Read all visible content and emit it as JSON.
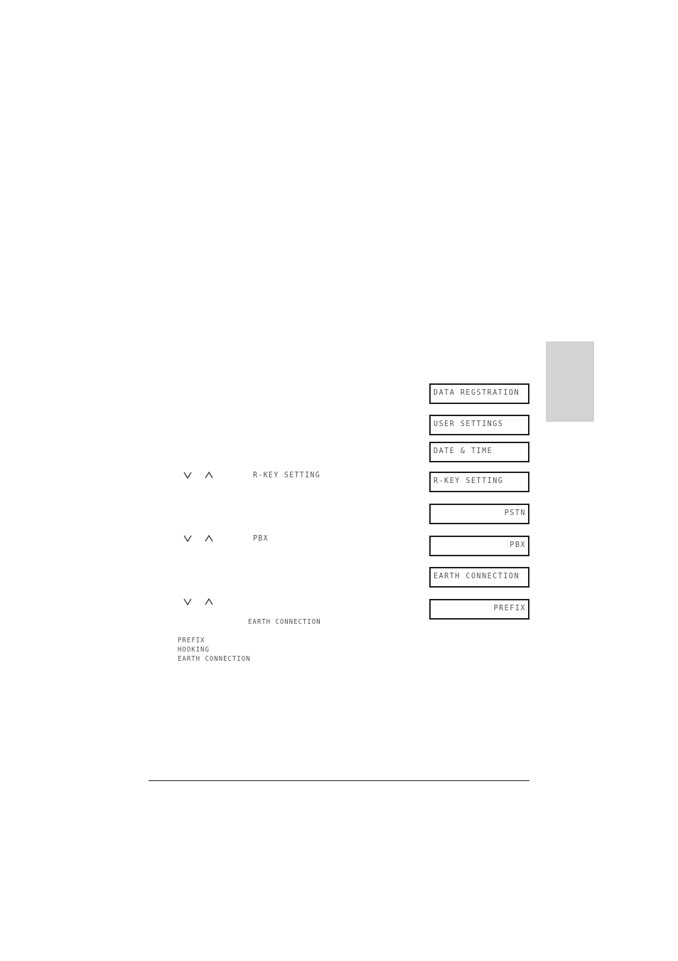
{
  "side_tab": {
    "color": "#d3d3d3"
  },
  "lcd_displays": [
    {
      "text": "DATA REGSTRATION",
      "align": "left"
    },
    {
      "text": "USER SETTINGS",
      "align": "left"
    },
    {
      "text": "DATE & TIME",
      "align": "left"
    },
    {
      "text": "R-KEY SETTING",
      "align": "left"
    },
    {
      "text": "PSTN",
      "align": "right"
    },
    {
      "text": "PBX",
      "align": "right"
    },
    {
      "text": "EARTH CONNECTION",
      "align": "left"
    },
    {
      "text": "PREFIX",
      "align": "right"
    }
  ],
  "steps": [
    {
      "arrows": [
        "down-arrow",
        "up-arrow"
      ],
      "target": "R-KEY SETTING"
    },
    {
      "arrows": [
        "down-arrow",
        "up-arrow"
      ],
      "target": "PBX"
    },
    {
      "arrows": [
        "down-arrow",
        "up-arrow"
      ],
      "target": ""
    }
  ],
  "inline_text": {
    "earth_connection": "EARTH CONNECTION"
  },
  "options_list": [
    "PREFIX",
    "HOOKING",
    "EARTH CONNECTION"
  ]
}
